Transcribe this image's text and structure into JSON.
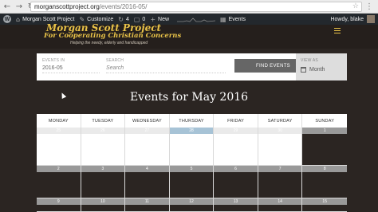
{
  "browser": {
    "url_host": "morganscottproject.org",
    "url_path": "/events/2016-05/"
  },
  "adminbar": {
    "site_name": "Morgan Scott Project",
    "customize": "Customize",
    "updates_count": "4",
    "comments_count": "0",
    "new_label": "New",
    "events_label": "Events",
    "greeting": "Howdy, blake"
  },
  "site": {
    "title": "Morgan Scott Project",
    "tagline": "For Cooperating Christian Concerns",
    "subtitle": "Helping the needy, elderly and handicapped"
  },
  "event_bar": {
    "events_in_label": "EVENTS IN",
    "events_in_value": "2016-05",
    "search_label": "SEARCH",
    "search_placeholder": "Search",
    "find_button": "FIND EVENTS",
    "view_as_label": "VIEW AS",
    "view_as_value": "Month"
  },
  "events_title": "Events for May 2016",
  "calendar": {
    "days": [
      "MONDAY",
      "TUESDAY",
      "WEDNESDAY",
      "THURSDAY",
      "FRIDAY",
      "SATURDAY",
      "SUNDAY"
    ],
    "weeks": [
      [
        {
          "n": "25",
          "s": "past"
        },
        {
          "n": "26",
          "s": "past"
        },
        {
          "n": "27",
          "s": "past"
        },
        {
          "n": "28",
          "s": "today"
        },
        {
          "n": "29",
          "s": "past"
        },
        {
          "n": "30",
          "s": "past"
        },
        {
          "n": "1",
          "s": "cur"
        }
      ],
      [
        {
          "n": "2",
          "s": "cur"
        },
        {
          "n": "3",
          "s": "cur"
        },
        {
          "n": "4",
          "s": "cur"
        },
        {
          "n": "5",
          "s": "cur"
        },
        {
          "n": "6",
          "s": "cur"
        },
        {
          "n": "7",
          "s": "cur"
        },
        {
          "n": "8",
          "s": "cur"
        }
      ],
      [
        {
          "n": "9",
          "s": "cur"
        },
        {
          "n": "10",
          "s": "cur"
        },
        {
          "n": "11",
          "s": "cur"
        },
        {
          "n": "12",
          "s": "cur"
        },
        {
          "n": "13",
          "s": "cur"
        },
        {
          "n": "14",
          "s": "cur"
        },
        {
          "n": "15",
          "s": "cur"
        }
      ]
    ]
  },
  "colors": {
    "accent": "#e8c248",
    "today": "#a7c3d6",
    "background": "#2b2522"
  }
}
